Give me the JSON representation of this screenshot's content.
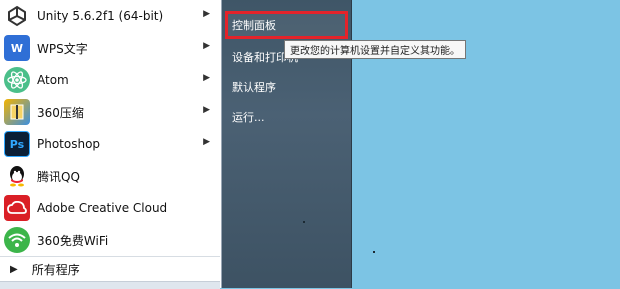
{
  "programs": [
    {
      "label": "Unity 5.6.2f1 (64-bit)",
      "icon": "unity-icon",
      "has_submenu": true
    },
    {
      "label": "WPS文字",
      "icon": "wps-icon",
      "has_submenu": true
    },
    {
      "label": "Atom",
      "icon": "atom-icon",
      "has_submenu": true
    },
    {
      "label": "360压缩",
      "icon": "360-zip-icon",
      "has_submenu": true
    },
    {
      "label": "Photoshop",
      "icon": "photoshop-icon",
      "has_submenu": true
    },
    {
      "label": "腾讯QQ",
      "icon": "qq-icon",
      "has_submenu": false
    },
    {
      "label": "Adobe Creative Cloud",
      "icon": "creative-cloud-icon",
      "has_submenu": false
    },
    {
      "label": "360免费WiFi",
      "icon": "wifi-icon",
      "has_submenu": false
    }
  ],
  "all_programs": "所有程序",
  "right_items": [
    {
      "label": "控制面板"
    },
    {
      "label": "设备和打印机"
    },
    {
      "label": "默认程序"
    },
    {
      "label": "运行..."
    }
  ],
  "tooltip": "更改您的计算机设置并自定义其功能。",
  "colors": {
    "desktop": "#7cc4e4",
    "pane": "#4b6174",
    "highlight": "#e4232a"
  }
}
